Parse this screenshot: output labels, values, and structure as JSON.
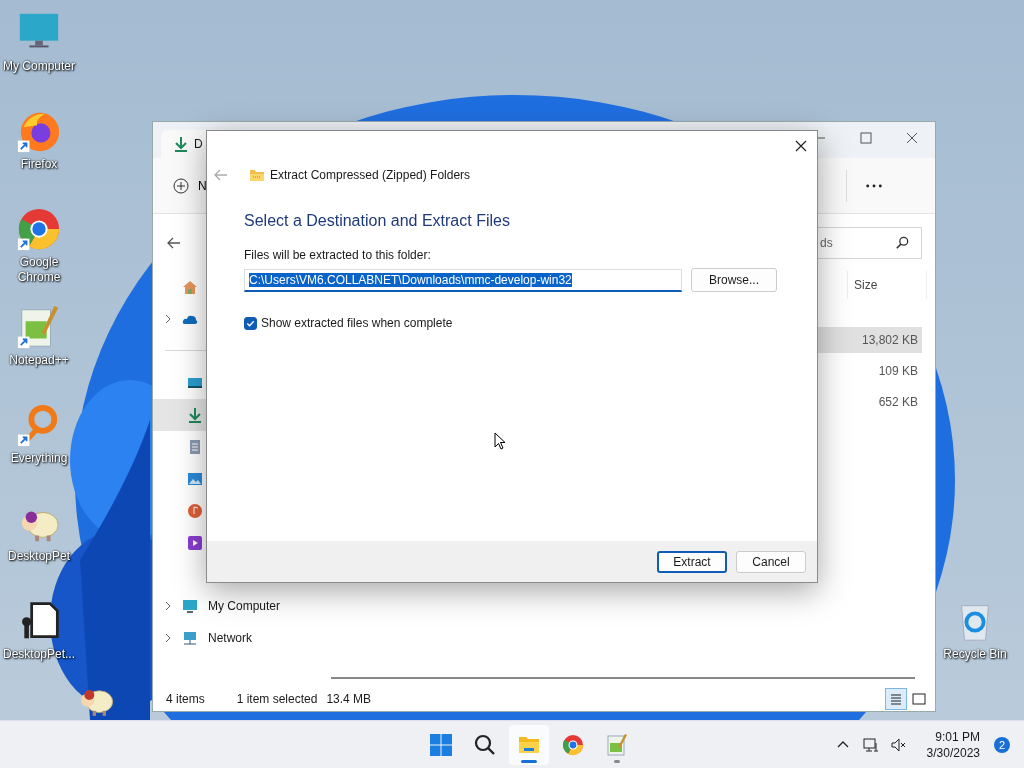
{
  "desktop": {
    "icons": [
      {
        "label": "My Computer",
        "kind": "computer",
        "shortcut": false
      },
      {
        "label": "Firefox",
        "kind": "firefox",
        "shortcut": true
      },
      {
        "label": "Google Chrome",
        "kind": "chrome",
        "shortcut": true
      },
      {
        "label": "Notepad++",
        "kind": "notepad",
        "shortcut": true
      },
      {
        "label": "Everything",
        "kind": "everything",
        "shortcut": true
      },
      {
        "label": "DesktopPet",
        "kind": "sheep",
        "shortcut": false
      },
      {
        "label": "DesktopPet...",
        "kind": "file",
        "shortcut": false
      }
    ],
    "recycle_bin": {
      "label": "Recycle Bin"
    }
  },
  "explorer": {
    "tab": {
      "label": "D"
    },
    "new_button": {
      "label": "N"
    },
    "search": {
      "placeholder": "ds"
    },
    "nav_top": [
      {
        "kind": "home",
        "expandable": false
      },
      {
        "kind": "cloud",
        "expandable": true
      }
    ],
    "nav_quick": [
      {
        "kind": "desktop",
        "selected": false
      },
      {
        "kind": "downloads",
        "selected": true
      },
      {
        "kind": "documents",
        "selected": false
      },
      {
        "kind": "pictures",
        "selected": false
      },
      {
        "kind": "music",
        "selected": false
      },
      {
        "kind": "videos",
        "selected": false
      }
    ],
    "tree": [
      {
        "label": "My Computer",
        "kind": "computer",
        "expanded": false
      },
      {
        "label": "Network",
        "kind": "network",
        "expanded": false
      }
    ],
    "size_column": {
      "label": "Size"
    },
    "rows": [
      {
        "size": "13,802 KB",
        "selected": true
      },
      {
        "size": "109 KB",
        "selected": false
      },
      {
        "size": "652 KB",
        "selected": false
      }
    ],
    "status_bar": {
      "items": "4 items",
      "selection": "1 item selected",
      "size": "13.4 MB"
    },
    "views": [
      {
        "kind": "details",
        "selected": true
      },
      {
        "kind": "tiles",
        "selected": false
      }
    ]
  },
  "dialog": {
    "title": "Extract Compressed (Zipped) Folders",
    "heading": "Select a Destination and Extract Files",
    "field_label": "Files will be extracted to this folder:",
    "path": "C:\\Users\\VM6.COLLABNET\\Downloads\\mmc-develop-win32",
    "path_selected": true,
    "browse": "Browse...",
    "show_files": {
      "label": "Show extracted files when complete",
      "checked": true
    },
    "buttons": [
      {
        "label": "Extract",
        "default": true
      },
      {
        "label": "Cancel",
        "default": false
      }
    ]
  },
  "taskbar": {
    "apps": [
      {
        "kind": "start",
        "active": false,
        "running": false
      },
      {
        "kind": "search",
        "active": false,
        "running": false
      },
      {
        "kind": "explorer",
        "active": true,
        "running": true
      },
      {
        "kind": "chrome",
        "active": false,
        "running": false
      },
      {
        "kind": "notepad",
        "active": false,
        "running": true
      }
    ],
    "clock": {
      "time": "9:01 PM",
      "date": "3/30/2023"
    },
    "notifications": "2"
  }
}
